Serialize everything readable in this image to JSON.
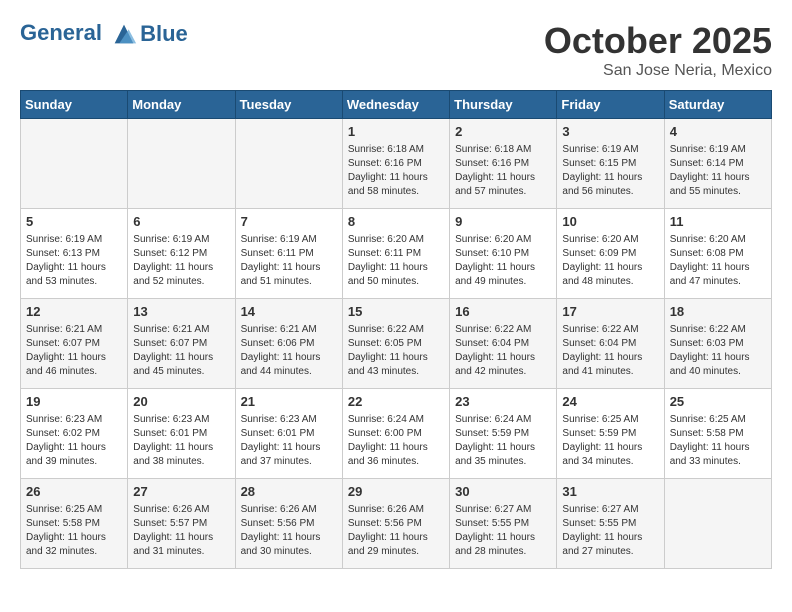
{
  "header": {
    "logo_line1": "General",
    "logo_line2": "Blue",
    "month": "October 2025",
    "location": "San Jose Neria, Mexico"
  },
  "weekdays": [
    "Sunday",
    "Monday",
    "Tuesday",
    "Wednesday",
    "Thursday",
    "Friday",
    "Saturday"
  ],
  "weeks": [
    [
      {
        "day": "",
        "info": ""
      },
      {
        "day": "",
        "info": ""
      },
      {
        "day": "",
        "info": ""
      },
      {
        "day": "1",
        "info": "Sunrise: 6:18 AM\nSunset: 6:16 PM\nDaylight: 11 hours\nand 58 minutes."
      },
      {
        "day": "2",
        "info": "Sunrise: 6:18 AM\nSunset: 6:16 PM\nDaylight: 11 hours\nand 57 minutes."
      },
      {
        "day": "3",
        "info": "Sunrise: 6:19 AM\nSunset: 6:15 PM\nDaylight: 11 hours\nand 56 minutes."
      },
      {
        "day": "4",
        "info": "Sunrise: 6:19 AM\nSunset: 6:14 PM\nDaylight: 11 hours\nand 55 minutes."
      }
    ],
    [
      {
        "day": "5",
        "info": "Sunrise: 6:19 AM\nSunset: 6:13 PM\nDaylight: 11 hours\nand 53 minutes."
      },
      {
        "day": "6",
        "info": "Sunrise: 6:19 AM\nSunset: 6:12 PM\nDaylight: 11 hours\nand 52 minutes."
      },
      {
        "day": "7",
        "info": "Sunrise: 6:19 AM\nSunset: 6:11 PM\nDaylight: 11 hours\nand 51 minutes."
      },
      {
        "day": "8",
        "info": "Sunrise: 6:20 AM\nSunset: 6:11 PM\nDaylight: 11 hours\nand 50 minutes."
      },
      {
        "day": "9",
        "info": "Sunrise: 6:20 AM\nSunset: 6:10 PM\nDaylight: 11 hours\nand 49 minutes."
      },
      {
        "day": "10",
        "info": "Sunrise: 6:20 AM\nSunset: 6:09 PM\nDaylight: 11 hours\nand 48 minutes."
      },
      {
        "day": "11",
        "info": "Sunrise: 6:20 AM\nSunset: 6:08 PM\nDaylight: 11 hours\nand 47 minutes."
      }
    ],
    [
      {
        "day": "12",
        "info": "Sunrise: 6:21 AM\nSunset: 6:07 PM\nDaylight: 11 hours\nand 46 minutes."
      },
      {
        "day": "13",
        "info": "Sunrise: 6:21 AM\nSunset: 6:07 PM\nDaylight: 11 hours\nand 45 minutes."
      },
      {
        "day": "14",
        "info": "Sunrise: 6:21 AM\nSunset: 6:06 PM\nDaylight: 11 hours\nand 44 minutes."
      },
      {
        "day": "15",
        "info": "Sunrise: 6:22 AM\nSunset: 6:05 PM\nDaylight: 11 hours\nand 43 minutes."
      },
      {
        "day": "16",
        "info": "Sunrise: 6:22 AM\nSunset: 6:04 PM\nDaylight: 11 hours\nand 42 minutes."
      },
      {
        "day": "17",
        "info": "Sunrise: 6:22 AM\nSunset: 6:04 PM\nDaylight: 11 hours\nand 41 minutes."
      },
      {
        "day": "18",
        "info": "Sunrise: 6:22 AM\nSunset: 6:03 PM\nDaylight: 11 hours\nand 40 minutes."
      }
    ],
    [
      {
        "day": "19",
        "info": "Sunrise: 6:23 AM\nSunset: 6:02 PM\nDaylight: 11 hours\nand 39 minutes."
      },
      {
        "day": "20",
        "info": "Sunrise: 6:23 AM\nSunset: 6:01 PM\nDaylight: 11 hours\nand 38 minutes."
      },
      {
        "day": "21",
        "info": "Sunrise: 6:23 AM\nSunset: 6:01 PM\nDaylight: 11 hours\nand 37 minutes."
      },
      {
        "day": "22",
        "info": "Sunrise: 6:24 AM\nSunset: 6:00 PM\nDaylight: 11 hours\nand 36 minutes."
      },
      {
        "day": "23",
        "info": "Sunrise: 6:24 AM\nSunset: 5:59 PM\nDaylight: 11 hours\nand 35 minutes."
      },
      {
        "day": "24",
        "info": "Sunrise: 6:25 AM\nSunset: 5:59 PM\nDaylight: 11 hours\nand 34 minutes."
      },
      {
        "day": "25",
        "info": "Sunrise: 6:25 AM\nSunset: 5:58 PM\nDaylight: 11 hours\nand 33 minutes."
      }
    ],
    [
      {
        "day": "26",
        "info": "Sunrise: 6:25 AM\nSunset: 5:58 PM\nDaylight: 11 hours\nand 32 minutes."
      },
      {
        "day": "27",
        "info": "Sunrise: 6:26 AM\nSunset: 5:57 PM\nDaylight: 11 hours\nand 31 minutes."
      },
      {
        "day": "28",
        "info": "Sunrise: 6:26 AM\nSunset: 5:56 PM\nDaylight: 11 hours\nand 30 minutes."
      },
      {
        "day": "29",
        "info": "Sunrise: 6:26 AM\nSunset: 5:56 PM\nDaylight: 11 hours\nand 29 minutes."
      },
      {
        "day": "30",
        "info": "Sunrise: 6:27 AM\nSunset: 5:55 PM\nDaylight: 11 hours\nand 28 minutes."
      },
      {
        "day": "31",
        "info": "Sunrise: 6:27 AM\nSunset: 5:55 PM\nDaylight: 11 hours\nand 27 minutes."
      },
      {
        "day": "",
        "info": ""
      }
    ]
  ]
}
